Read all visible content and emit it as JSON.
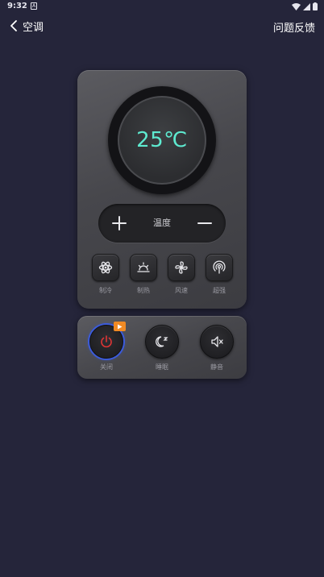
{
  "status_bar": {
    "time": "9:32",
    "notif_glyph": "A"
  },
  "header": {
    "back_label": "空调",
    "feedback_label": "问题反馈"
  },
  "remote": {
    "temperature": "25℃",
    "temp_label": "温度",
    "modes": [
      {
        "label": "制冷",
        "icon": "snowflake-icon"
      },
      {
        "label": "制热",
        "icon": "sun-icon"
      },
      {
        "label": "风速",
        "icon": "fan-icon"
      },
      {
        "label": "超强",
        "icon": "signal-icon"
      }
    ]
  },
  "controls": {
    "power_label": "关闭",
    "sleep_label": "睡眠",
    "mute_label": "静音"
  },
  "colors": {
    "background": "#25253a",
    "temperature_text": "#5eead0",
    "power_icon": "#e03535",
    "power_ring": "#3b5bdb",
    "ad_badge": "#f08a24"
  }
}
